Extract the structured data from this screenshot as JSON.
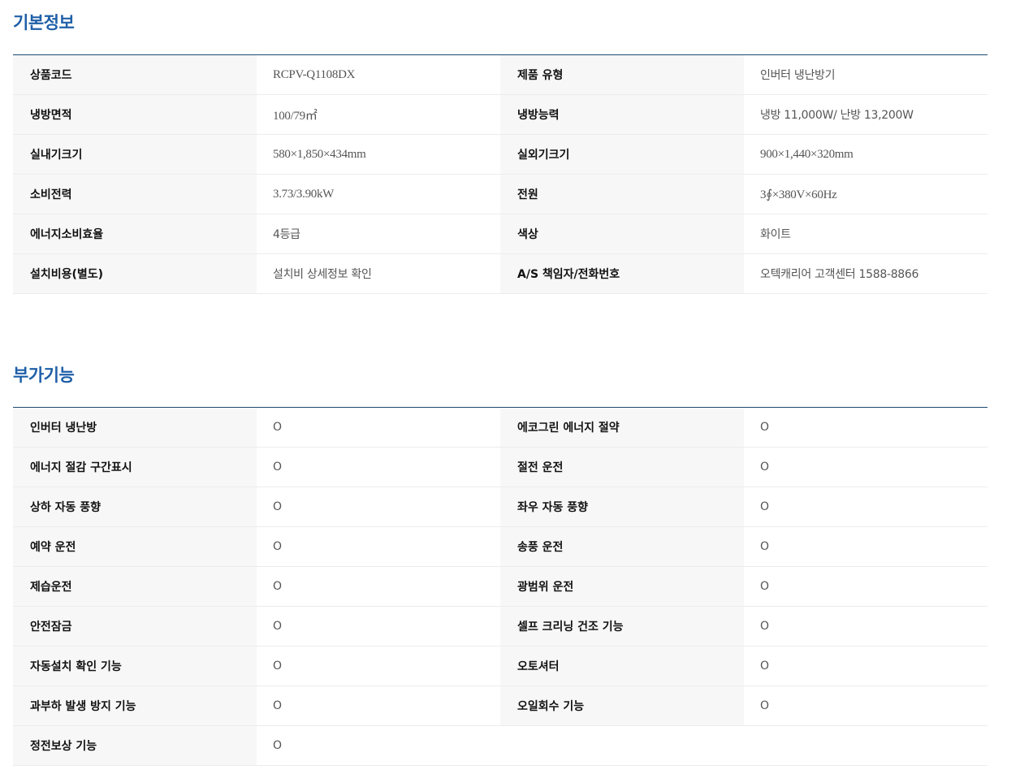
{
  "basic": {
    "title": "기본정보",
    "rows": [
      [
        {
          "label": "상품코드",
          "value": "RCPV-Q1108DX"
        },
        {
          "label": "제품 유형",
          "value": "인버터 냉난방기"
        }
      ],
      [
        {
          "label": "냉방면적",
          "value": "100/79㎡"
        },
        {
          "label": "냉방능력",
          "value": "냉방 11,000W/ 난방 13,200W"
        }
      ],
      [
        {
          "label": "실내기크기",
          "value": "580×1,850×434mm"
        },
        {
          "label": "실외기크기",
          "value": "900×1,440×320mm"
        }
      ],
      [
        {
          "label": "소비전력",
          "value": "3.73/3.90kW"
        },
        {
          "label": "전원",
          "value": "3∮×380V×60Hz"
        }
      ],
      [
        {
          "label": "에너지소비효율",
          "value": "4등급"
        },
        {
          "label": "색상",
          "value": "화이트"
        }
      ],
      [
        {
          "label": "설치비용(별도)",
          "value": "설치비 상세정보 확인"
        },
        {
          "label": "A/S 책임자/전화번호",
          "value": "오텍캐리어 고객센터 1588-8866"
        }
      ]
    ]
  },
  "extra": {
    "title": "부가기능",
    "rows": [
      [
        {
          "label": "인버터 냉난방",
          "value": "O"
        },
        {
          "label": "에코그린 에너지 절약",
          "value": "O"
        }
      ],
      [
        {
          "label": "에너지 절감 구간표시",
          "value": "O"
        },
        {
          "label": "절전 운전",
          "value": "O"
        }
      ],
      [
        {
          "label": "상하 자동 풍향",
          "value": "O"
        },
        {
          "label": "좌우 자동 풍향",
          "value": "O"
        }
      ],
      [
        {
          "label": "예약 운전",
          "value": "O"
        },
        {
          "label": "송풍 운전",
          "value": "O"
        }
      ],
      [
        {
          "label": "제습운전",
          "value": "O"
        },
        {
          "label": "광범위 운전",
          "value": "O"
        }
      ],
      [
        {
          "label": "안전잠금",
          "value": "O"
        },
        {
          "label": "셀프 크리닝 건조 기능",
          "value": "O"
        }
      ],
      [
        {
          "label": "자동설치 확인 기능",
          "value": "O"
        },
        {
          "label": "오토셔터",
          "value": "O"
        }
      ],
      [
        {
          "label": "과부하 발생 방지 기능",
          "value": "O"
        },
        {
          "label": "오일회수 기능",
          "value": "O"
        }
      ],
      [
        {
          "label": "정전보상 기능",
          "value": "O"
        }
      ]
    ]
  },
  "colors": {
    "title": "#1f5fa8",
    "label_bg": "#f7f7f7",
    "top_border": "#1d4a6e",
    "row_border": "#ececec"
  }
}
